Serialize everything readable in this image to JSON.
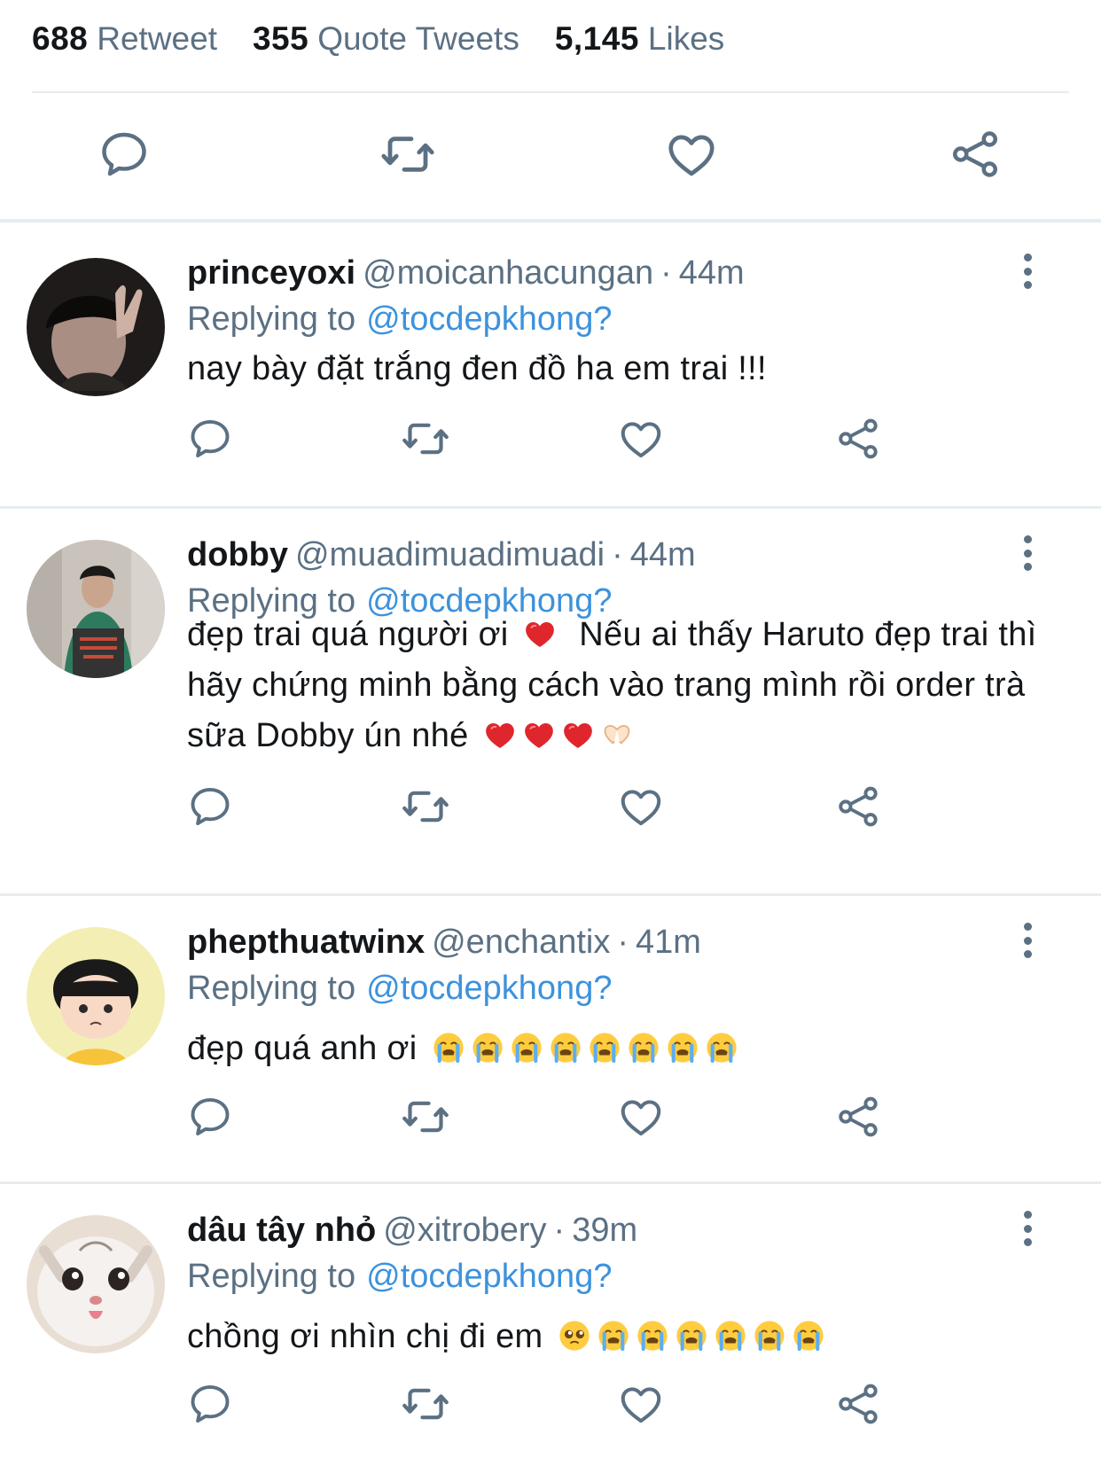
{
  "stats": {
    "retweets": {
      "num": "688",
      "label": "Retweet"
    },
    "quotes": {
      "num": "355",
      "label": "Quote Tweets"
    },
    "likes": {
      "num": "5,145",
      "label": "Likes"
    }
  },
  "reply_prefix": "Replying to",
  "replies": [
    {
      "name": "princeyoxi",
      "handle": "@moicanhacungan",
      "time": "44m",
      "reply_to": "@tocdepkhong?",
      "text": "nay bày đặt trắng đen đồ ha em trai !!!",
      "emoji": []
    },
    {
      "name": "dobby",
      "handle": "@muadimuadimuadi",
      "time": "44m",
      "reply_to": "@tocdepkhong?",
      "text_part1": "đẹp trai quá người ơi",
      "text_part2": "Nếu ai thấy Haruto đẹp trai thì hãy chứng minh bằng cách vào trang mình rồi order trà sữa Dobby ún nhé",
      "emoji": [
        "red-heart",
        "red-heart",
        "red-heart",
        "red-heart",
        "heart-hands"
      ]
    },
    {
      "name": "phepthuatwinx",
      "handle": "@enchantix",
      "time": "41m",
      "reply_to": "@tocdepkhong?",
      "text": "đẹp quá anh ơi",
      "emoji": [
        "loudly-crying-face",
        "loudly-crying-face",
        "loudly-crying-face",
        "loudly-crying-face",
        "loudly-crying-face",
        "loudly-crying-face",
        "loudly-crying-face",
        "loudly-crying-face"
      ]
    },
    {
      "name": "dâu tây nhỏ",
      "handle": "@xitrobery",
      "time": "39m",
      "reply_to": "@tocdepkhong?",
      "text": "chồng ơi nhìn chị đi em",
      "emoji": [
        "pleading-face",
        "loudly-crying-face",
        "loudly-crying-face",
        "loudly-crying-face",
        "loudly-crying-face",
        "loudly-crying-face",
        "loudly-crying-face"
      ]
    }
  ],
  "icons": {
    "reply": "speech-bubble-icon",
    "retweet": "retweet-icon",
    "like": "heart-icon",
    "share": "share-icon",
    "more": "vertical-dots-icon"
  },
  "colors": {
    "link": "#3d92dc",
    "secondary_text": "#5b7083",
    "icon": "#5b7083",
    "heart_emoji": "#e0262d"
  }
}
